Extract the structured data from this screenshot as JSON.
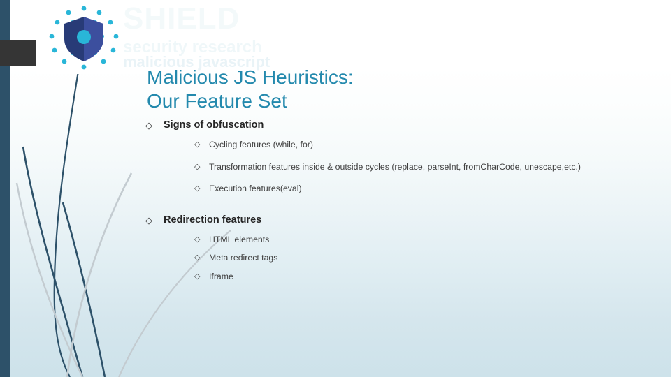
{
  "slide": {
    "title": "Malicious JS Heuristics:\nOur Feature Set",
    "bullet_glyph": "◇",
    "colors": {
      "title": "#2389ad",
      "body_text": "#404040",
      "heading_text": "#262626",
      "accent_bar": "#2d5169",
      "dark_block": "#353535",
      "logo_shield_dark": "#283b77",
      "logo_shield_light": "#3c4f9e",
      "logo_dot": "#29b6d8",
      "background_top": "#ffffff",
      "background_bottom": "#cde2ea"
    },
    "watermark": {
      "line1": "SHIELD",
      "line2": "security research",
      "line3": "malicious javascript"
    },
    "logo": {
      "name": "shield-security-logo"
    },
    "outline": [
      {
        "level": 1,
        "text": "Signs of obfuscation",
        "children": [
          {
            "level": 2,
            "text": "Cycling features (while, for)"
          },
          {
            "level": 2,
            "text": "Transformation features inside & outside cycles (replace, parseInt, fromCharCode, unescape,etc.)"
          },
          {
            "level": 2,
            "text": "Execution features(eval)"
          }
        ]
      },
      {
        "level": 1,
        "text": "Redirection features",
        "children": [
          {
            "level": 2,
            "text": "HTML elements"
          },
          {
            "level": 2,
            "text": "Meta redirect tags"
          },
          {
            "level": 2,
            "text": "Iframe"
          }
        ]
      }
    ]
  }
}
